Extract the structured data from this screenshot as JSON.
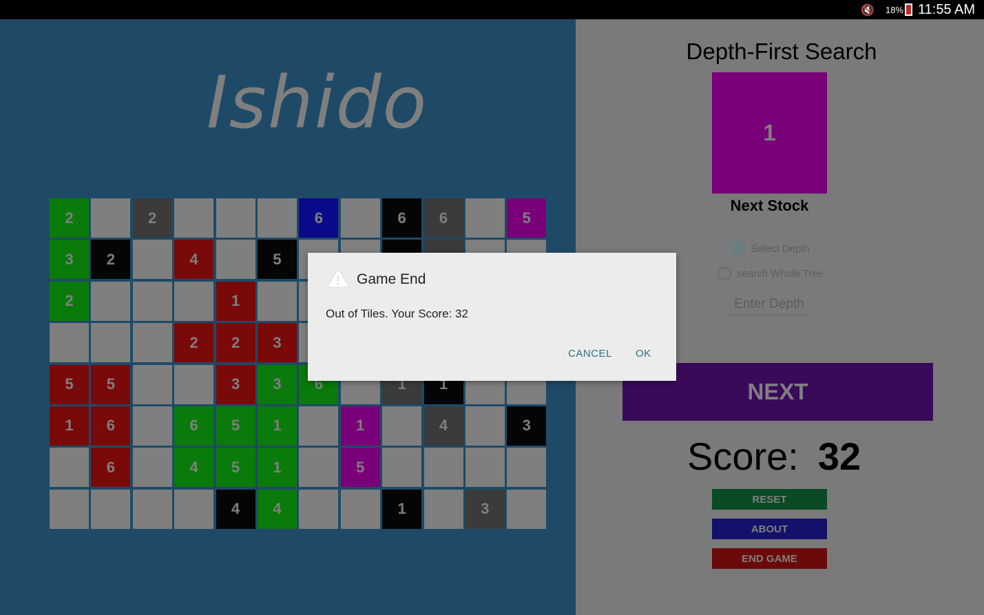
{
  "status_bar": {
    "battery": "18%",
    "time": "11:55 AM"
  },
  "app": {
    "logo": "Ishido"
  },
  "board": {
    "rows": [
      [
        {
          "c": "green",
          "n": "2"
        },
        {
          "c": "empty",
          "n": ""
        },
        {
          "c": "gray",
          "n": "2"
        },
        {
          "c": "empty",
          "n": ""
        },
        {
          "c": "empty",
          "n": ""
        },
        {
          "c": "empty",
          "n": ""
        },
        {
          "c": "blue",
          "n": "6"
        },
        {
          "c": "empty",
          "n": ""
        },
        {
          "c": "black",
          "n": "6"
        },
        {
          "c": "gray",
          "n": "6"
        },
        {
          "c": "empty",
          "n": ""
        },
        {
          "c": "purple",
          "n": "5"
        }
      ],
      [
        {
          "c": "green",
          "n": "3"
        },
        {
          "c": "black",
          "n": "2"
        },
        {
          "c": "empty",
          "n": ""
        },
        {
          "c": "red",
          "n": "4"
        },
        {
          "c": "empty",
          "n": ""
        },
        {
          "c": "black",
          "n": "5"
        },
        {
          "c": "empty",
          "n": ""
        },
        {
          "c": "empty",
          "n": ""
        },
        {
          "c": "black",
          "n": ""
        },
        {
          "c": "gray",
          "n": ""
        },
        {
          "c": "empty",
          "n": ""
        },
        {
          "c": "empty",
          "n": ""
        }
      ],
      [
        {
          "c": "green",
          "n": "2"
        },
        {
          "c": "empty",
          "n": ""
        },
        {
          "c": "empty",
          "n": ""
        },
        {
          "c": "empty",
          "n": ""
        },
        {
          "c": "red",
          "n": "1"
        },
        {
          "c": "empty",
          "n": ""
        },
        {
          "c": "empty",
          "n": ""
        },
        {
          "c": "empty",
          "n": ""
        },
        {
          "c": "empty",
          "n": ""
        },
        {
          "c": "empty",
          "n": ""
        },
        {
          "c": "empty",
          "n": ""
        },
        {
          "c": "empty",
          "n": ""
        }
      ],
      [
        {
          "c": "empty",
          "n": ""
        },
        {
          "c": "empty",
          "n": ""
        },
        {
          "c": "empty",
          "n": ""
        },
        {
          "c": "red",
          "n": "2"
        },
        {
          "c": "red",
          "n": "2"
        },
        {
          "c": "red",
          "n": "3"
        },
        {
          "c": "empty",
          "n": ""
        },
        {
          "c": "empty",
          "n": ""
        },
        {
          "c": "empty",
          "n": ""
        },
        {
          "c": "empty",
          "n": ""
        },
        {
          "c": "empty",
          "n": ""
        },
        {
          "c": "empty",
          "n": ""
        }
      ],
      [
        {
          "c": "red",
          "n": "5"
        },
        {
          "c": "red",
          "n": "5"
        },
        {
          "c": "empty",
          "n": ""
        },
        {
          "c": "empty",
          "n": ""
        },
        {
          "c": "red",
          "n": "3"
        },
        {
          "c": "green",
          "n": "3"
        },
        {
          "c": "green",
          "n": "6"
        },
        {
          "c": "empty",
          "n": ""
        },
        {
          "c": "gray",
          "n": "1"
        },
        {
          "c": "black",
          "n": "1"
        },
        {
          "c": "empty",
          "n": ""
        },
        {
          "c": "empty",
          "n": ""
        }
      ],
      [
        {
          "c": "red",
          "n": "1"
        },
        {
          "c": "red",
          "n": "6"
        },
        {
          "c": "empty",
          "n": ""
        },
        {
          "c": "green",
          "n": "6"
        },
        {
          "c": "green",
          "n": "5"
        },
        {
          "c": "green",
          "n": "1"
        },
        {
          "c": "empty",
          "n": ""
        },
        {
          "c": "purple",
          "n": "1"
        },
        {
          "c": "empty",
          "n": ""
        },
        {
          "c": "gray",
          "n": "4"
        },
        {
          "c": "empty",
          "n": ""
        },
        {
          "c": "black",
          "n": "3"
        }
      ],
      [
        {
          "c": "empty",
          "n": ""
        },
        {
          "c": "red",
          "n": "6"
        },
        {
          "c": "empty",
          "n": ""
        },
        {
          "c": "green",
          "n": "4"
        },
        {
          "c": "green",
          "n": "5"
        },
        {
          "c": "green",
          "n": "1"
        },
        {
          "c": "empty",
          "n": ""
        },
        {
          "c": "purple",
          "n": "5"
        },
        {
          "c": "empty",
          "n": ""
        },
        {
          "c": "empty",
          "n": ""
        },
        {
          "c": "empty",
          "n": ""
        },
        {
          "c": "empty",
          "n": ""
        }
      ],
      [
        {
          "c": "empty",
          "n": ""
        },
        {
          "c": "empty",
          "n": ""
        },
        {
          "c": "empty",
          "n": ""
        },
        {
          "c": "empty",
          "n": ""
        },
        {
          "c": "black",
          "n": "4"
        },
        {
          "c": "green",
          "n": "4"
        },
        {
          "c": "empty",
          "n": ""
        },
        {
          "c": "empty",
          "n": ""
        },
        {
          "c": "black",
          "n": "1"
        },
        {
          "c": "empty",
          "n": ""
        },
        {
          "c": "gray",
          "n": "3"
        },
        {
          "c": "empty",
          "n": ""
        }
      ]
    ]
  },
  "side_panel": {
    "algorithm_title": "Depth-First Search",
    "next_stock": {
      "value": "1",
      "color": "purple",
      "label": "Next Stock"
    },
    "radio_select_depth": "Select Depth",
    "radio_whole_tree": "search Whole Tree",
    "depth_placeholder": "Enter Depth",
    "next_button": "NEXT",
    "score_label": "Score:",
    "score_value": "32",
    "reset_button": "RESET",
    "about_button": "ABOUT",
    "end_game_button": "END GAME"
  },
  "dialog": {
    "title": "Game End",
    "message": "Out of Tiles. Your Score: 32",
    "cancel": "CANCEL",
    "ok": "OK"
  }
}
